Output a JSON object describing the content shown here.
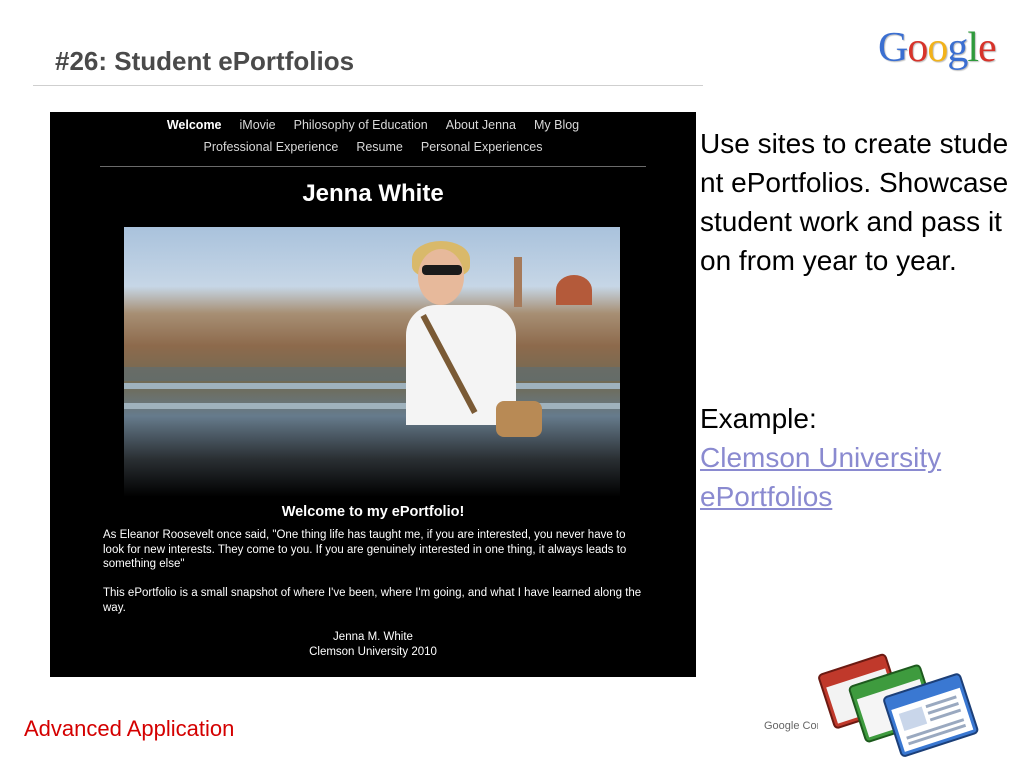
{
  "slide": {
    "title": "#26: Student ePortfolios",
    "logo_letters": [
      {
        "ch": "G",
        "color": "#3b6fd1"
      },
      {
        "ch": "o",
        "color": "#d7332a"
      },
      {
        "ch": "o",
        "color": "#f2b21a"
      },
      {
        "ch": "g",
        "color": "#3b6fd1"
      },
      {
        "ch": "l",
        "color": "#2f9a3c"
      },
      {
        "ch": "e",
        "color": "#d7332a"
      }
    ]
  },
  "portfolio": {
    "nav_row_1": [
      "Welcome",
      "iMovie",
      "Philosophy of Education",
      "About Jenna",
      "My Blog"
    ],
    "nav_row_2": [
      "Professional Experience",
      "Resume",
      "Personal Experiences"
    ],
    "active_nav": "Welcome",
    "site_title": "Jenna White",
    "welcome_heading": "Welcome to my ePortfolio!",
    "paragraph_1": "As Eleanor Roosevelt once said, \"One thing life has taught me, if you are interested, you never have to look for new interests. They come to you. If you are genuinely interested in one thing, it always leads to something else\"",
    "paragraph_2": "This ePortfolio is a small snapshot of where I've been, where I'm going, and what I have learned along the way.",
    "signature_name": "Jenna M. White",
    "signature_school": "Clemson University 2010"
  },
  "side": {
    "body": "Use sites to create student ePortfolios.  Showcase student work and pass it on from year to year.",
    "example_label": "Example:",
    "example_link": "Clemson University ePortfolios"
  },
  "footer": {
    "left": "Advanced Application",
    "brand": "Google Confidential"
  },
  "colors": {
    "footer_red": "#d40000",
    "link": "#8a8ad0",
    "title_gray": "#4a4a4a"
  }
}
